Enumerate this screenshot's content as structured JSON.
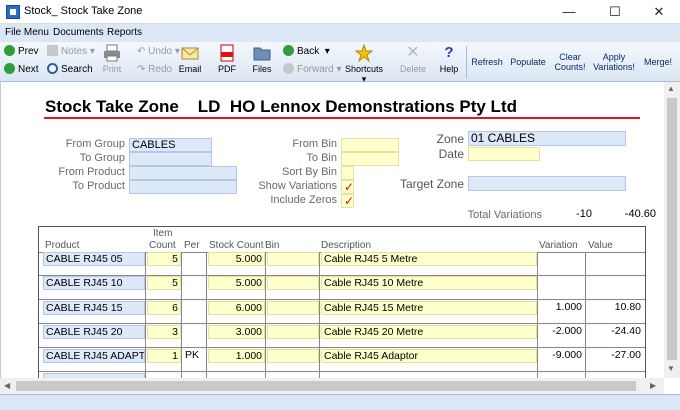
{
  "window": {
    "title": "Stock_ Stock Take Zone",
    "minimize": "—",
    "maximize": "☐",
    "close": "✕"
  },
  "menu": {
    "items": [
      "File Menu",
      "Documents",
      "Reports"
    ]
  },
  "toolbar": {
    "prev": "Prev",
    "next": "Next",
    "notes": "Notes",
    "search": "Search",
    "undo": "Undo",
    "redo": "Redo",
    "print": "Print",
    "email": "Email",
    "pdf": "PDF",
    "files": "Files",
    "back": "Back",
    "forward": "Forward",
    "shortcuts": "Shortcuts",
    "delete": "Delete",
    "help": "Help",
    "refresh": "Refresh",
    "populate": "Populate",
    "clear_counts": "Clear Counts!",
    "apply_variations": "Apply Variations!",
    "merge": "Merge!"
  },
  "header": {
    "title": "Stock Take Zone",
    "company": "LD  HO Lennox Demonstrations Pty Ltd"
  },
  "filters": {
    "from_group_label": "From Group",
    "from_group": "CABLES",
    "to_group_label": "To Group",
    "to_group": "",
    "from_product_label": "From Product",
    "from_product": "",
    "to_product_label": "To Product",
    "to_product": "",
    "from_bin_label": "From Bin",
    "from_bin": "",
    "to_bin_label": "To Bin",
    "to_bin": "",
    "sort_by_bin_label": "Sort By Bin",
    "sort_by_bin": "",
    "show_variations_label": "Show Variations",
    "show_variations": "✓",
    "include_zeros_label": "Include Zeros",
    "include_zeros": "✓",
    "zone_label": "Zone",
    "zone": "01 CABLES",
    "date_label": "Date",
    "date": "",
    "target_zone_label": "Target Zone",
    "target_zone": ""
  },
  "totals": {
    "label": "Total Variations",
    "variation": "-10",
    "value": "-40.60"
  },
  "grid": {
    "headers": {
      "product": "Product",
      "item": "Item",
      "count": "Count",
      "per": "Per",
      "stock_count": "Stock Count",
      "bin": "Bin",
      "description": "Description",
      "variation": "Variation",
      "value": "Value"
    },
    "rows": [
      {
        "product": "CABLE RJ45 05",
        "count": "5",
        "per": "",
        "stock_count": "5.000",
        "bin": "",
        "description": "Cable RJ45 5 Metre",
        "variation": "",
        "value": ""
      },
      {
        "product": "CABLE RJ45 10",
        "count": "5",
        "per": "",
        "stock_count": "5.000",
        "bin": "",
        "description": "Cable RJ45 10 Metre",
        "variation": "",
        "value": ""
      },
      {
        "product": "CABLE RJ45 15",
        "count": "6",
        "per": "",
        "stock_count": "6.000",
        "bin": "",
        "description": "Cable RJ45 15 Metre",
        "variation": "1.000",
        "value": "10.80"
      },
      {
        "product": "CABLE RJ45 20",
        "count": "3",
        "per": "",
        "stock_count": "3.000",
        "bin": "",
        "description": "Cable RJ45 20 Metre",
        "variation": "-2.000",
        "value": "-24.40"
      },
      {
        "product": "CABLE RJ45 ADAPT",
        "count": "1",
        "per": "PK",
        "stock_count": "1.000",
        "bin": "",
        "description": "Cable RJ45 Adaptor",
        "variation": "-9.000",
        "value": "-27.00"
      }
    ]
  },
  "colors": {
    "accent": "#e2141c",
    "field_blue": "#dde8f8",
    "field_yellow": "#ffffcc",
    "toolbar": "#dbe6f3"
  }
}
